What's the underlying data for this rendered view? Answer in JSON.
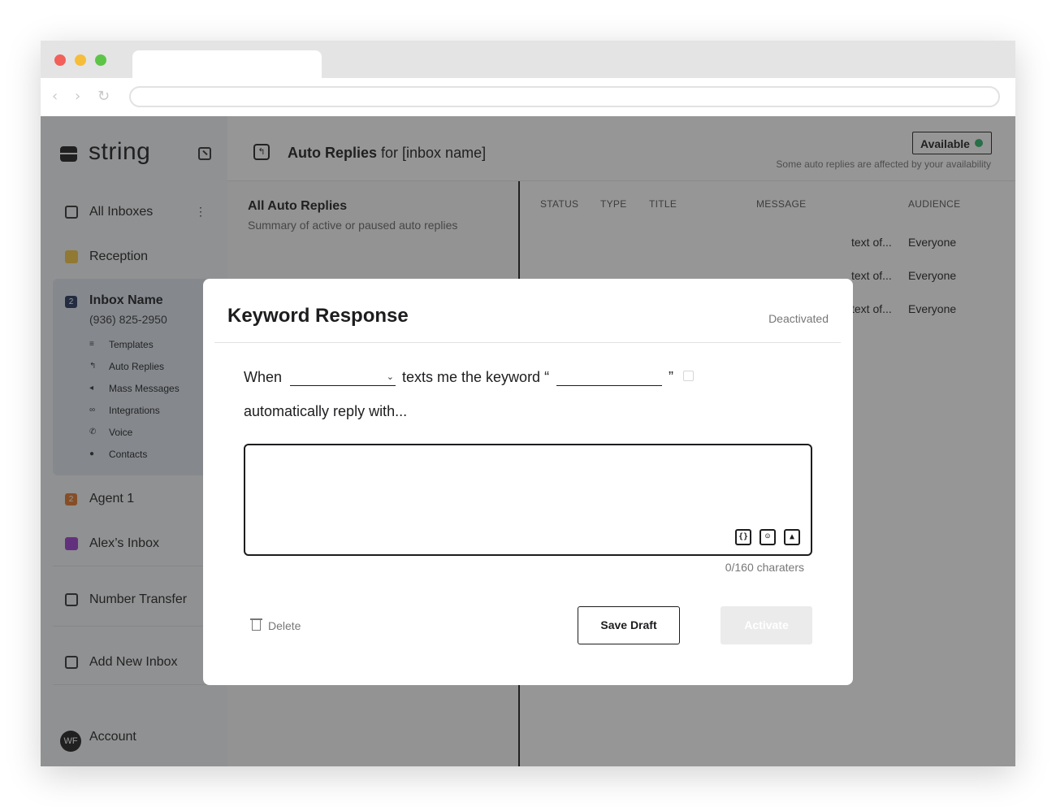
{
  "sidebar": {
    "brand": "string",
    "items": [
      {
        "label": "All Inboxes",
        "color": "#333333",
        "icon": "inbox-icon"
      },
      {
        "label": "Reception",
        "color": "#f5c542",
        "icon": "color-square-icon"
      },
      {
        "label": "Agent 1",
        "color": "#e0762b",
        "badge": "2"
      },
      {
        "label": "Alex’s Inbox",
        "color": "#9b3fd1",
        "icon": "color-square-icon"
      },
      {
        "label": "Number Transfer",
        "icon": "transfer-icon"
      },
      {
        "label": "Add New Inbox",
        "icon": "add-inbox-icon"
      }
    ],
    "active_inbox": {
      "badge": "2",
      "badge_color": "#23355c",
      "name": "Inbox Name",
      "phone": "(936) 825-2950",
      "sub_items": [
        {
          "label": "Templates",
          "icon": "list-icon"
        },
        {
          "label": "Auto Replies",
          "icon": "reply-icon"
        },
        {
          "label": "Mass Messages",
          "icon": "megaphone-icon"
        },
        {
          "label": "Integrations",
          "icon": "link-icon"
        },
        {
          "label": "Voice",
          "icon": "phone-icon"
        },
        {
          "label": "Contacts",
          "icon": "person-icon"
        }
      ]
    },
    "account": {
      "initials": "WF",
      "label": "Account"
    }
  },
  "header": {
    "title_bold": "Auto Replies",
    "title_rest": " for [inbox name]",
    "availability": {
      "label": "Available",
      "color": "#2fb56a"
    },
    "availability_note": "Some auto replies are affected by your availability"
  },
  "left_panel": {
    "title": "All Auto Replies",
    "subtitle": "Summary of active or paused auto replies"
  },
  "table": {
    "columns": [
      "STATUS",
      "TYPE",
      "TITLE",
      "MESSAGE",
      "AUDIENCE"
    ],
    "rows": [
      {
        "message_tail": "text of...",
        "audience": "Everyone"
      },
      {
        "message_tail": "text of...",
        "audience": "Everyone"
      },
      {
        "message_tail": "text of...",
        "audience": "Everyone"
      }
    ]
  },
  "modal": {
    "title": "Keyword Response",
    "status": "Deactivated",
    "when": "When",
    "texts_keyword": "texts me the keyword “",
    "close_quote": "”",
    "auto_reply": "automatically reply with...",
    "message_value": "",
    "char_count": "0/160 charaters",
    "delete_label": "Delete",
    "save_label": "Save Draft",
    "activate_label": "Activate",
    "textarea_icons": [
      "variable-icon",
      "emoji-icon",
      "image-icon"
    ]
  }
}
